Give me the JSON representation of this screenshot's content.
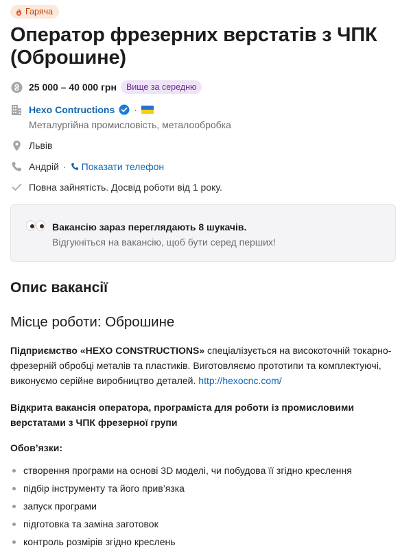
{
  "badge": {
    "label": "Гаряча",
    "icon": "flame-icon"
  },
  "title": "Оператор фрезерних верстатів з ЧПК (Оброшине)",
  "salary": {
    "amount": "25 000 – 40 000 грн",
    "badge": "Вище за середню",
    "icon": "hryvnia-icon"
  },
  "company": {
    "name": "Hexo Contructions",
    "verified_icon": "verified-check-icon",
    "flag_icon": "ukraine-flag-icon",
    "industry": "Металургійна промисловість, металообробка",
    "icon": "building-icon"
  },
  "location": {
    "city": "Львів",
    "icon": "map-pin-icon"
  },
  "contact": {
    "name": "Андрій",
    "separator": "·",
    "phone_link": "Показати телефон",
    "icon": "phone-icon"
  },
  "conditions": {
    "text": "Повна зайнятість. Досвід роботи від 1 року.",
    "icon": "check-icon"
  },
  "watchers": {
    "title": "Вакансію зараз переглядають 8 шукачів.",
    "subtitle": "Відгукніться на вакансію, щоб бути серед перших!",
    "icon": "eyes-icon"
  },
  "description": {
    "heading": "Опис вакансії",
    "place": "Місце роботи: Оброшине",
    "intro_bold": "Підприємство «HEXO CONSTRUCTIONS»",
    "intro_text": " спеціалізується на високоточній токарно-фрезерній обробці металів та пластиків. Виготовляємо прототипи та комплектуючі, виконуємо серійне виробництво деталей. ",
    "intro_link": "http://hexocnc.com/",
    "open_position": "Відкрита вакансія оператора, програміста для роботи із промисловими верстатами з ЧПК фрезерної групи",
    "duties_label": "Обов’язки:",
    "duties": [
      "створення програми на основі 3D моделі, чи побудова її згідно креслення",
      "підбір інструменту та його прив’язка",
      "запуск програми",
      "підготовка та заміна заготовок",
      "контроль розмірів згідно креслень"
    ]
  },
  "colors": {
    "link": "#1266ae",
    "hot_bg": "#fde9dc",
    "hot_text": "#c2410c",
    "above_bg": "#efe4f7",
    "above_text": "#6b2c91"
  }
}
